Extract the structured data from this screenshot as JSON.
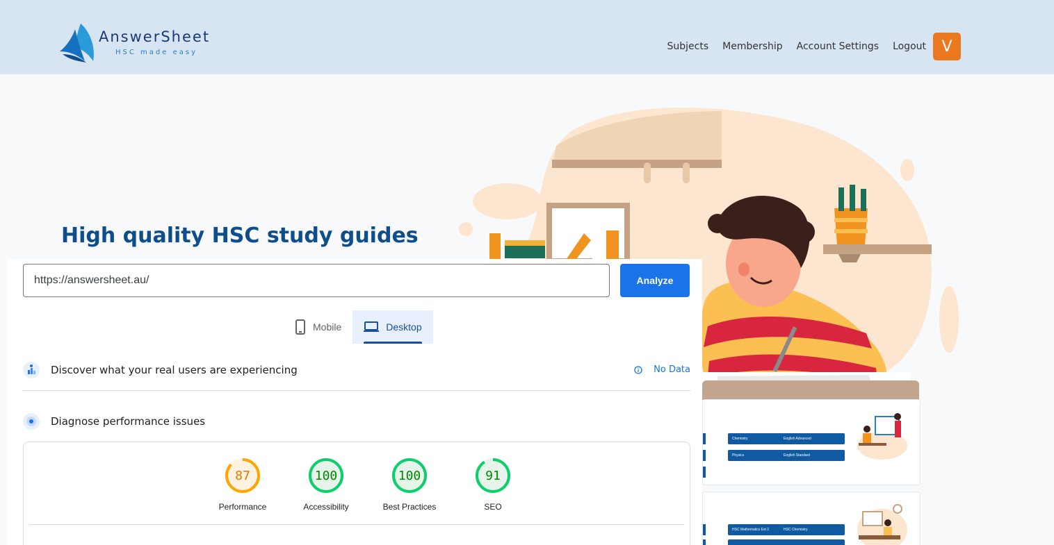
{
  "brand": {
    "name": "AnswerSheet",
    "tagline": "HSC made easy"
  },
  "nav": {
    "items": [
      "Subjects",
      "Membership",
      "Account Settings",
      "Logout"
    ],
    "avatar_initial": "V",
    "avatar_color": "#e9781f"
  },
  "hero": {
    "title": "High quality HSC study guides"
  },
  "cards": {
    "card1_tabs": [
      "Chemistry",
      "English Advanced",
      "Physics",
      "English Standard"
    ],
    "card2_tabs": [
      "HSC Mathematics Ext 2",
      "HSC Chemistry"
    ]
  },
  "psi": {
    "url_value": "https://answersheet.au/",
    "analyze_label": "Analyze",
    "tabs": [
      {
        "label": "Mobile",
        "icon": "smartphone-icon",
        "active": false
      },
      {
        "label": "Desktop",
        "icon": "laptop-icon",
        "active": true
      }
    ],
    "real_users_title": "Discover what your real users are experiencing",
    "no_data_label": "No Data",
    "diagnose_title": "Diagnose performance issues",
    "scores": [
      {
        "label": "Performance",
        "value": 87,
        "color": "#e67700",
        "fill": "#fff3e0",
        "ring": "#ffa400"
      },
      {
        "label": "Accessibility",
        "value": 100,
        "color": "#008800",
        "fill": "#e6f4ea",
        "ring": "#0cce6b"
      },
      {
        "label": "Best Practices",
        "value": 100,
        "color": "#008800",
        "fill": "#e6f4ea",
        "ring": "#0cce6b"
      },
      {
        "label": "SEO",
        "value": 91,
        "color": "#008800",
        "fill": "#e6f4ea",
        "ring": "#0cce6b"
      }
    ],
    "accent_color": "#1a73e8"
  }
}
